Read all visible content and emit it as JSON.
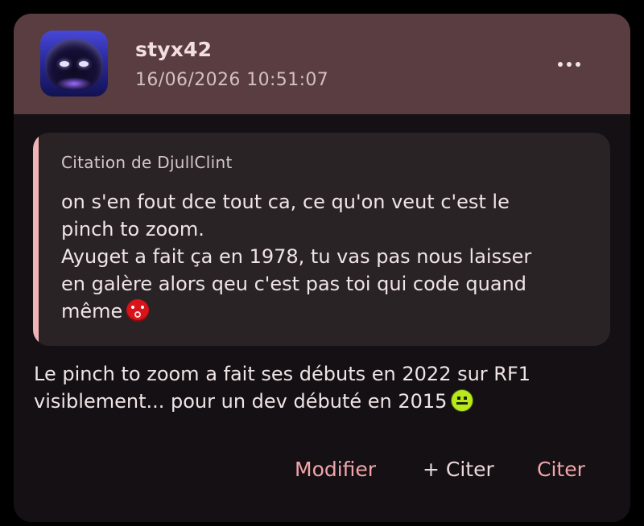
{
  "post": {
    "author": "styx42",
    "timestamp": "16/06/2026 10:51:07",
    "more_icon": "more-horizontal-icon",
    "quote": {
      "author_label": "Citation de DjullClint",
      "lines": [
        "on s'en fout dce tout ca, ce qu'on veut c'est le",
        "pinch to zoom.",
        "Ayuget a fait ça en 1978, tu vas pas nous laisser",
        "en galère alors qeu c'est pas toi qui code quand",
        "même"
      ],
      "emoji": "angry-face-emoji"
    },
    "body": {
      "lines": [
        "Le pinch to zoom a fait ses débuts en 2022 sur RF1",
        "visiblement... pour un dev débuté en 2015"
      ],
      "emoji": "smile-face-emoji"
    },
    "actions": {
      "edit_label": "Modifier",
      "plus_quote_label": "+ Citer",
      "quote_label": "Citer"
    }
  },
  "colors": {
    "header_bg": "#5a3d41",
    "card_bg": "#151013",
    "quote_bg": "#2a2326",
    "quote_accent": "#f0b4b7",
    "action_accent": "#f0a6ab"
  }
}
